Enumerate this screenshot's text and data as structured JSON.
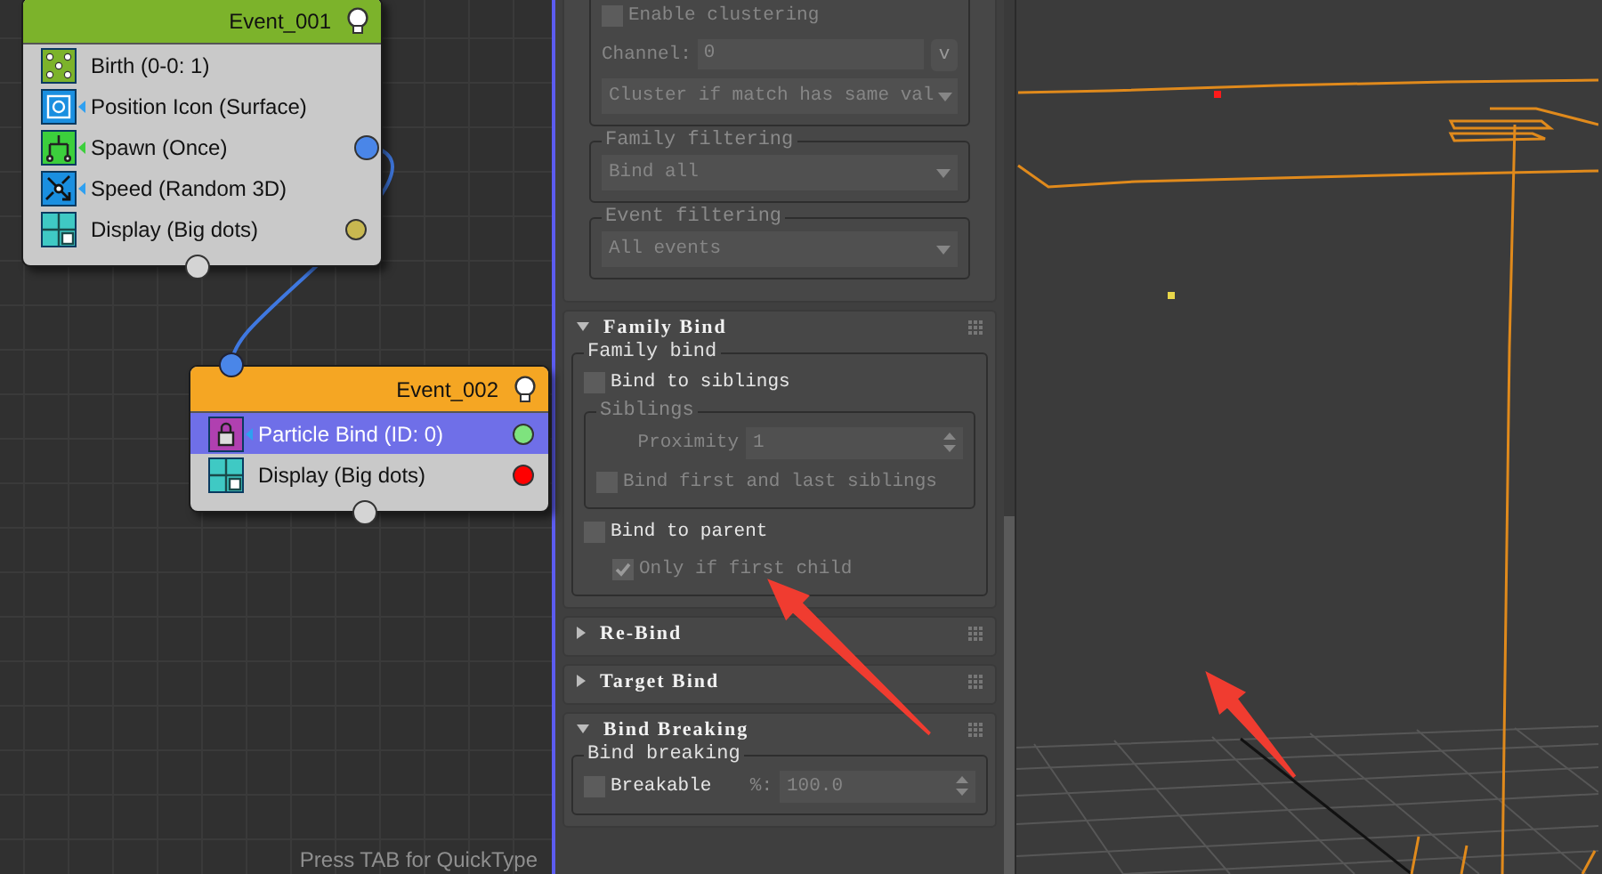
{
  "node_editor": {
    "events": [
      {
        "title": "Event_001",
        "color": "#7cb32b",
        "operators": [
          {
            "label": "Birth (0-0: 1)",
            "kind": "birth",
            "selected": false
          },
          {
            "label": "Position Icon (Surface)",
            "kind": "position",
            "selected": false
          },
          {
            "label": "Spawn (Once)",
            "kind": "spawn",
            "selected": false,
            "color": "#4a86e8"
          },
          {
            "label": "Speed (Random 3D)",
            "kind": "speed",
            "selected": false
          },
          {
            "label": "Display (Big dots)",
            "kind": "display",
            "selected": false,
            "color": "#c8b850"
          }
        ]
      },
      {
        "title": "Event_002",
        "color": "#f5a623",
        "operators": [
          {
            "label": "Particle Bind (ID: 0)",
            "kind": "bind",
            "selected": true,
            "color": "#7ee37e"
          },
          {
            "label": "Display (Big dots)",
            "kind": "display",
            "selected": false,
            "color": "#ff0000"
          }
        ]
      }
    ],
    "hint": "Press TAB for QuickType"
  },
  "panel": {
    "top_rollout": {
      "items": [
        {
          "kind": "group",
          "disabled": true,
          "items": [
            {
              "kind": "checkbox",
              "label": "Enable clustering",
              "checked": false,
              "disabled": true
            },
            {
              "kind": "field_button",
              "label": "Channel:",
              "value": "0",
              "button": "v",
              "disabled": true
            },
            {
              "kind": "dropdown",
              "value": "Cluster if match has same val",
              "disabled": true
            }
          ]
        },
        {
          "kind": "group",
          "title": "Family filtering",
          "disabled": true,
          "items": [
            {
              "kind": "dropdown",
              "value": "Bind all",
              "disabled": true
            }
          ]
        },
        {
          "kind": "group",
          "title": "Event filtering",
          "disabled": true,
          "items": [
            {
              "kind": "dropdown",
              "value": "All events",
              "disabled": true
            }
          ]
        }
      ]
    },
    "rollouts": [
      {
        "title": "Family Bind",
        "expanded": true,
        "items": [
          {
            "kind": "group",
            "title": "Family bind",
            "disabled": false,
            "items": [
              {
                "kind": "checkbox",
                "label": "Bind to siblings",
                "checked": false,
                "disabled": false
              },
              {
                "kind": "group",
                "title": "Siblings",
                "disabled": true,
                "items": [
                  {
                    "kind": "spinner",
                    "label": "Proximity",
                    "value": "1",
                    "disabled": true
                  },
                  {
                    "kind": "checkbox",
                    "label": "Bind first and last siblings",
                    "checked": false,
                    "disabled": true
                  }
                ]
              },
              {
                "kind": "checkbox",
                "label": "Bind to parent",
                "checked": false,
                "disabled": false
              },
              {
                "kind": "checkbox",
                "label": "Only if first child",
                "checked": true,
                "disabled": true,
                "indent": true
              }
            ]
          }
        ]
      },
      {
        "title": "Re-Bind",
        "expanded": false
      },
      {
        "title": "Target Bind",
        "expanded": false
      },
      {
        "title": "Bind Breaking",
        "expanded": true,
        "items": [
          {
            "kind": "group",
            "title": "Bind breaking",
            "disabled": false,
            "items": [
              {
                "kind": "inline",
                "items": [
                  {
                    "kind": "checkbox",
                    "label": "Breakable",
                    "checked": false,
                    "disabled": false
                  },
                  {
                    "kind": "spinner",
                    "label": "%:",
                    "value": "100.0",
                    "disabled": true
                  }
                ]
              }
            ]
          }
        ]
      }
    ]
  }
}
